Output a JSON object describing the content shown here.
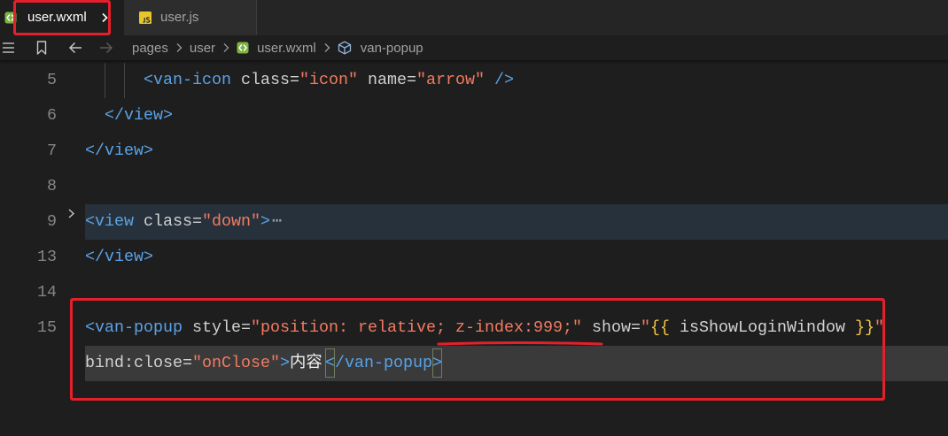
{
  "theme": {
    "tag": "#5aa2e6",
    "attr": "#d0d0d0",
    "string": "#f27b61",
    "brace": "#f5c842",
    "plain": "#d4d4d4",
    "text": "#f0f0f0",
    "muted": "#9a9a9a",
    "annotation": "#e3202b"
  },
  "tabs": [
    {
      "label": "user.wxml",
      "icon": "wxml-file-icon",
      "active": true
    },
    {
      "label": "user.js",
      "icon": "js-file-icon",
      "active": false
    }
  ],
  "toolbar": {
    "icons": [
      "outline-list-icon",
      "bookmark-icon",
      "back-arrow-icon",
      "forward-arrow-icon"
    ]
  },
  "breadcrumb": [
    {
      "label": "pages"
    },
    {
      "label": "user"
    },
    {
      "label": "user.wxml",
      "icon": "wxml-file-icon"
    },
    {
      "label": "van-popup",
      "icon": "cube-icon"
    }
  ],
  "editor": {
    "active_line": 15,
    "lines": [
      {
        "number": 5,
        "rows": [
          [
            {
              "k": "ws",
              "t": "      "
            },
            {
              "k": "tag",
              "t": "<van-icon"
            },
            {
              "k": "plain",
              "t": " "
            },
            {
              "k": "attr",
              "t": "class="
            },
            {
              "k": "string",
              "t": "\"icon\""
            },
            {
              "k": "plain",
              "t": " "
            },
            {
              "k": "attr",
              "t": "name="
            },
            {
              "k": "string",
              "t": "\"arrow\""
            },
            {
              "k": "plain",
              "t": " "
            },
            {
              "k": "tag",
              "t": "/>"
            }
          ]
        ]
      },
      {
        "number": 6,
        "rows": [
          [
            {
              "k": "ws",
              "t": "  "
            },
            {
              "k": "tag",
              "t": "</view>"
            }
          ]
        ]
      },
      {
        "number": 7,
        "rows": [
          [
            {
              "k": "tag",
              "t": "</view>"
            }
          ]
        ]
      },
      {
        "number": 8,
        "rows": [
          []
        ]
      },
      {
        "number": 9,
        "folded": true,
        "rows": [
          [
            {
              "k": "tag",
              "t": "<view"
            },
            {
              "k": "plain",
              "t": " "
            },
            {
              "k": "attr",
              "t": "class="
            },
            {
              "k": "string",
              "t": "\"down\""
            },
            {
              "k": "tag",
              "t": ">"
            },
            {
              "k": "fold",
              "t": "⋯"
            }
          ]
        ]
      },
      {
        "number": 13,
        "rows": [
          [
            {
              "k": "tag",
              "t": "</view>"
            }
          ]
        ]
      },
      {
        "number": 14,
        "rows": [
          []
        ]
      },
      {
        "number": 15,
        "rows": [
          [
            {
              "k": "tag",
              "t": "<van-popup"
            },
            {
              "k": "plain",
              "t": " "
            },
            {
              "k": "attr",
              "t": "style="
            },
            {
              "k": "string",
              "t": "\"position: relative; z-index:999;\""
            },
            {
              "k": "plain",
              "t": " "
            },
            {
              "k": "attr",
              "t": "show="
            },
            {
              "k": "string",
              "t": "\""
            },
            {
              "k": "brace",
              "t": "{{"
            },
            {
              "k": "plain",
              "t": " isShowLoginWindow "
            },
            {
              "k": "brace",
              "t": "}}"
            },
            {
              "k": "string",
              "t": "\""
            }
          ],
          [
            {
              "k": "attr",
              "t": "bind:close="
            },
            {
              "k": "string",
              "t": "\"onClose\""
            },
            {
              "k": "tag",
              "t": ">"
            },
            {
              "k": "text",
              "t": "内容"
            },
            {
              "k": "tag",
              "t": "<",
              "match": true
            },
            {
              "k": "tag",
              "t": "/van-popup"
            },
            {
              "k": "tag",
              "t": ">",
              "match": true
            }
          ]
        ]
      }
    ]
  }
}
